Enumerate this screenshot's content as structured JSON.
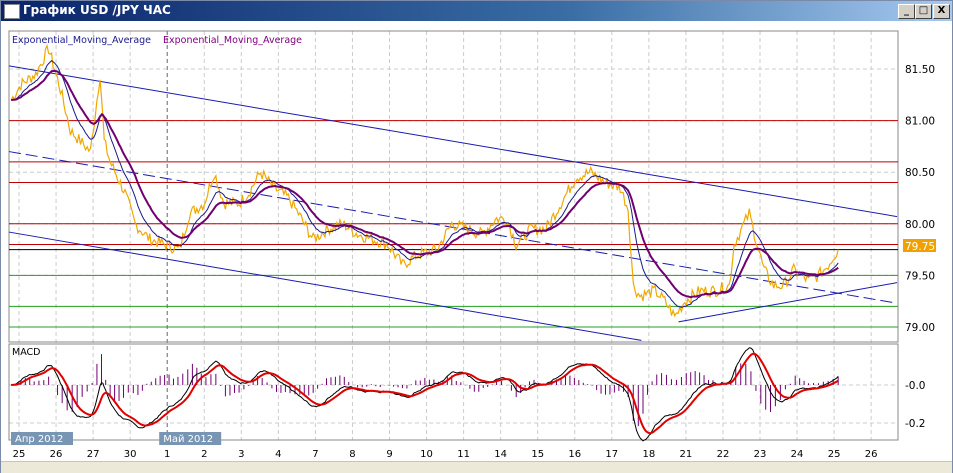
{
  "window": {
    "title": "График USD /JPY  ЧАС",
    "minimize": "_",
    "maximize": "□",
    "close": "X"
  },
  "legend": {
    "ema1": "Exponential_Moving_Average",
    "ema2": "Exponential_Moving_Average",
    "ema1_color": "#1a1a8c",
    "ema2_color": "#800080"
  },
  "macd_label": "MACD",
  "current_price": "79.75",
  "colors": {
    "price": "#f0a800",
    "ema_fast": "#1a1a8c",
    "ema_slow": "#700070",
    "macd": "#000000",
    "signal": "#e00000",
    "hist": "#700070",
    "resistance": "#c00000",
    "support": "#20a020",
    "trend": "#1a1ab0",
    "badge": "#f0a000"
  },
  "month_labels": [
    {
      "text": "Апр 2012",
      "day": 0
    },
    {
      "text": "Май 2012",
      "day": 4
    }
  ],
  "chart_data": [
    {
      "type": "line",
      "title": "USD/JPY hourly",
      "ylim": [
        78.85,
        81.85
      ],
      "yticks": [
        "81.50",
        "81.00",
        "80.50",
        "80.00",
        "79.50",
        "79.00"
      ],
      "xticks": [
        "25",
        "26",
        "27",
        "30",
        "1",
        "2",
        "3",
        "4",
        "7",
        "8",
        "9",
        "10",
        "11",
        "14",
        "15",
        "16",
        "17",
        "18",
        "21",
        "22",
        "23",
        "24",
        "25",
        "26"
      ],
      "price": [
        [
          -0.21,
          81.2
        ],
        [
          0.05,
          81.35
        ],
        [
          0.45,
          81.45
        ],
        [
          0.8,
          81.7
        ],
        [
          1.12,
          81.3
        ],
        [
          1.39,
          80.9
        ],
        [
          1.66,
          80.8
        ],
        [
          1.93,
          80.7
        ],
        [
          2.19,
          81.45
        ],
        [
          2.3,
          80.8
        ],
        [
          2.46,
          80.6
        ],
        [
          2.86,
          80.3
        ],
        [
          3.13,
          80.0
        ],
        [
          3.53,
          79.85
        ],
        [
          3.93,
          79.8
        ],
        [
          4.33,
          79.75
        ],
        [
          4.6,
          80.1
        ],
        [
          5.0,
          80.2
        ],
        [
          5.27,
          80.5
        ],
        [
          5.53,
          80.2
        ],
        [
          5.94,
          80.2
        ],
        [
          6.2,
          80.3
        ],
        [
          6.52,
          80.5
        ],
        [
          6.87,
          80.35
        ],
        [
          7.27,
          80.25
        ],
        [
          7.54,
          80.1
        ],
        [
          7.94,
          79.85
        ],
        [
          8.34,
          79.95
        ],
        [
          8.74,
          80.0
        ],
        [
          9.14,
          79.9
        ],
        [
          9.55,
          79.85
        ],
        [
          9.95,
          79.8
        ],
        [
          10.35,
          79.6
        ],
        [
          10.75,
          79.7
        ],
        [
          11.28,
          79.75
        ],
        [
          11.68,
          80.0
        ],
        [
          12.09,
          79.95
        ],
        [
          12.49,
          79.9
        ],
        [
          12.89,
          80.05
        ],
        [
          13.16,
          80.05
        ],
        [
          13.42,
          79.8
        ],
        [
          13.82,
          79.95
        ],
        [
          14.22,
          79.95
        ],
        [
          14.63,
          80.2
        ],
        [
          15.03,
          80.45
        ],
        [
          15.43,
          80.5
        ],
        [
          15.83,
          80.4
        ],
        [
          16.23,
          80.35
        ],
        [
          16.44,
          80.15
        ],
        [
          16.58,
          79.4
        ],
        [
          16.76,
          79.3
        ],
        [
          17.17,
          79.35
        ],
        [
          17.43,
          79.25
        ],
        [
          17.7,
          79.1
        ],
        [
          17.97,
          79.25
        ],
        [
          18.37,
          79.35
        ],
        [
          18.77,
          79.35
        ],
        [
          19.17,
          79.4
        ],
        [
          19.3,
          79.8
        ],
        [
          19.57,
          80.0
        ],
        [
          19.71,
          80.1
        ],
        [
          19.89,
          79.85
        ],
        [
          20.11,
          79.55
        ],
        [
          20.37,
          79.4
        ],
        [
          20.64,
          79.4
        ],
        [
          20.91,
          79.55
        ],
        [
          21.31,
          79.45
        ],
        [
          21.58,
          79.5
        ],
        [
          21.84,
          79.6
        ],
        [
          22.11,
          79.75
        ]
      ],
      "horizontal_lines": {
        "resistance": [
          81.0,
          80.6,
          80.4,
          80.0,
          79.8
        ],
        "support": [
          79.5,
          79.2,
          79.0
        ],
        "current": 79.75
      },
      "trend_lines": [
        {
          "style": "solid",
          "from": [
            -0.27,
            81.53
          ],
          "to": [
            23.7,
            80.07
          ]
        },
        {
          "style": "dashed",
          "from": [
            -0.27,
            80.7
          ],
          "to": [
            23.7,
            79.23
          ]
        },
        {
          "style": "solid",
          "from": [
            -0.27,
            79.92
          ],
          "to": [
            16.8,
            78.87
          ]
        },
        {
          "style": "solid",
          "from": [
            17.8,
            79.05
          ],
          "to": [
            23.7,
            79.43
          ]
        }
      ]
    },
    {
      "type": "line",
      "title": "MACD",
      "ylim": [
        -0.29,
        0.2
      ],
      "yticks": [
        "-0.0",
        "-0.2"
      ],
      "grid": true
    }
  ]
}
